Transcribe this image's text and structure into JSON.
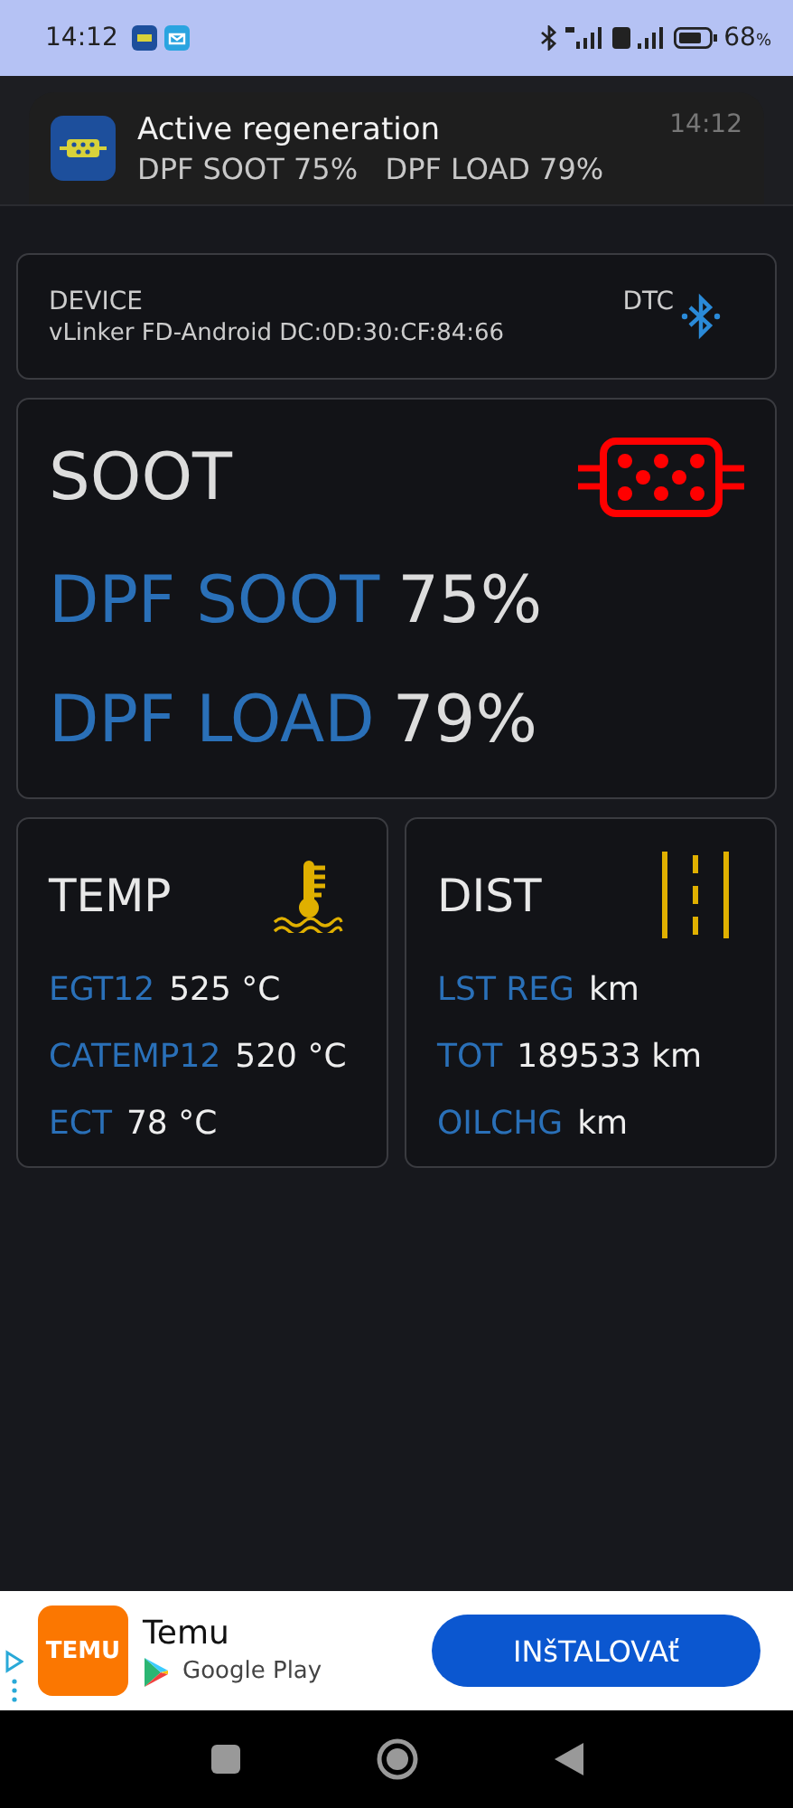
{
  "status_bar": {
    "time": "14:12",
    "battery": "68",
    "battery_unit": "%"
  },
  "notification": {
    "title": "Active regeneration",
    "text": "DPF SOOT 75%   DPF LOAD 79%",
    "time": "14:12"
  },
  "device": {
    "label": "DEVICE",
    "address": "vLinker FD-Android DC:0D:30:CF:84:66",
    "dtc_label": "DTC"
  },
  "soot": {
    "title": "SOOT",
    "rows": [
      {
        "label": "DPF SOOT",
        "value": "75%"
      },
      {
        "label": "DPF LOAD",
        "value": "79%"
      }
    ]
  },
  "panels": [
    {
      "title": "TEMP",
      "kind": "temp",
      "rows": [
        {
          "label": "EGT12",
          "value": "525 °C"
        },
        {
          "label": "CATEMP12",
          "value": "520 °C"
        },
        {
          "label": "ECT",
          "value": "78 °C"
        }
      ]
    },
    {
      "title": "DIST",
      "kind": "dist",
      "rows": [
        {
          "label": "LST REG",
          "value": "km"
        },
        {
          "label": "TOT",
          "value": "189533 km"
        },
        {
          "label": "OILCHG",
          "value": "km"
        }
      ]
    }
  ],
  "ad": {
    "logo": "TEMU",
    "title": "Temu",
    "store": "Google Play",
    "button": "INšTALOVAť"
  }
}
